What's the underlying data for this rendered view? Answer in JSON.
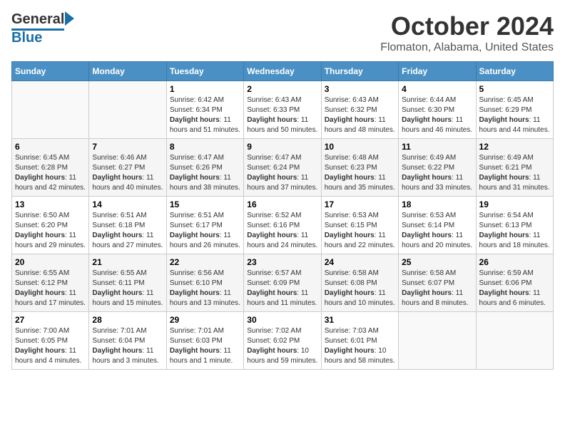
{
  "header": {
    "logo_line1": "General",
    "logo_line2": "Blue",
    "title": "October 2024",
    "subtitle": "Flomaton, Alabama, United States"
  },
  "calendar": {
    "days_of_week": [
      "Sunday",
      "Monday",
      "Tuesday",
      "Wednesday",
      "Thursday",
      "Friday",
      "Saturday"
    ],
    "weeks": [
      [
        {
          "day": "",
          "info": ""
        },
        {
          "day": "",
          "info": ""
        },
        {
          "day": "1",
          "info": "Sunrise: 6:42 AM\nSunset: 6:34 PM\nDaylight: 11 hours and 51 minutes."
        },
        {
          "day": "2",
          "info": "Sunrise: 6:43 AM\nSunset: 6:33 PM\nDaylight: 11 hours and 50 minutes."
        },
        {
          "day": "3",
          "info": "Sunrise: 6:43 AM\nSunset: 6:32 PM\nDaylight: 11 hours and 48 minutes."
        },
        {
          "day": "4",
          "info": "Sunrise: 6:44 AM\nSunset: 6:30 PM\nDaylight: 11 hours and 46 minutes."
        },
        {
          "day": "5",
          "info": "Sunrise: 6:45 AM\nSunset: 6:29 PM\nDaylight: 11 hours and 44 minutes."
        }
      ],
      [
        {
          "day": "6",
          "info": "Sunrise: 6:45 AM\nSunset: 6:28 PM\nDaylight: 11 hours and 42 minutes."
        },
        {
          "day": "7",
          "info": "Sunrise: 6:46 AM\nSunset: 6:27 PM\nDaylight: 11 hours and 40 minutes."
        },
        {
          "day": "8",
          "info": "Sunrise: 6:47 AM\nSunset: 6:26 PM\nDaylight: 11 hours and 38 minutes."
        },
        {
          "day": "9",
          "info": "Sunrise: 6:47 AM\nSunset: 6:24 PM\nDaylight: 11 hours and 37 minutes."
        },
        {
          "day": "10",
          "info": "Sunrise: 6:48 AM\nSunset: 6:23 PM\nDaylight: 11 hours and 35 minutes."
        },
        {
          "day": "11",
          "info": "Sunrise: 6:49 AM\nSunset: 6:22 PM\nDaylight: 11 hours and 33 minutes."
        },
        {
          "day": "12",
          "info": "Sunrise: 6:49 AM\nSunset: 6:21 PM\nDaylight: 11 hours and 31 minutes."
        }
      ],
      [
        {
          "day": "13",
          "info": "Sunrise: 6:50 AM\nSunset: 6:20 PM\nDaylight: 11 hours and 29 minutes."
        },
        {
          "day": "14",
          "info": "Sunrise: 6:51 AM\nSunset: 6:18 PM\nDaylight: 11 hours and 27 minutes."
        },
        {
          "day": "15",
          "info": "Sunrise: 6:51 AM\nSunset: 6:17 PM\nDaylight: 11 hours and 26 minutes."
        },
        {
          "day": "16",
          "info": "Sunrise: 6:52 AM\nSunset: 6:16 PM\nDaylight: 11 hours and 24 minutes."
        },
        {
          "day": "17",
          "info": "Sunrise: 6:53 AM\nSunset: 6:15 PM\nDaylight: 11 hours and 22 minutes."
        },
        {
          "day": "18",
          "info": "Sunrise: 6:53 AM\nSunset: 6:14 PM\nDaylight: 11 hours and 20 minutes."
        },
        {
          "day": "19",
          "info": "Sunrise: 6:54 AM\nSunset: 6:13 PM\nDaylight: 11 hours and 18 minutes."
        }
      ],
      [
        {
          "day": "20",
          "info": "Sunrise: 6:55 AM\nSunset: 6:12 PM\nDaylight: 11 hours and 17 minutes."
        },
        {
          "day": "21",
          "info": "Sunrise: 6:55 AM\nSunset: 6:11 PM\nDaylight: 11 hours and 15 minutes."
        },
        {
          "day": "22",
          "info": "Sunrise: 6:56 AM\nSunset: 6:10 PM\nDaylight: 11 hours and 13 minutes."
        },
        {
          "day": "23",
          "info": "Sunrise: 6:57 AM\nSunset: 6:09 PM\nDaylight: 11 hours and 11 minutes."
        },
        {
          "day": "24",
          "info": "Sunrise: 6:58 AM\nSunset: 6:08 PM\nDaylight: 11 hours and 10 minutes."
        },
        {
          "day": "25",
          "info": "Sunrise: 6:58 AM\nSunset: 6:07 PM\nDaylight: 11 hours and 8 minutes."
        },
        {
          "day": "26",
          "info": "Sunrise: 6:59 AM\nSunset: 6:06 PM\nDaylight: 11 hours and 6 minutes."
        }
      ],
      [
        {
          "day": "27",
          "info": "Sunrise: 7:00 AM\nSunset: 6:05 PM\nDaylight: 11 hours and 4 minutes."
        },
        {
          "day": "28",
          "info": "Sunrise: 7:01 AM\nSunset: 6:04 PM\nDaylight: 11 hours and 3 minutes."
        },
        {
          "day": "29",
          "info": "Sunrise: 7:01 AM\nSunset: 6:03 PM\nDaylight: 11 hours and 1 minute."
        },
        {
          "day": "30",
          "info": "Sunrise: 7:02 AM\nSunset: 6:02 PM\nDaylight: 10 hours and 59 minutes."
        },
        {
          "day": "31",
          "info": "Sunrise: 7:03 AM\nSunset: 6:01 PM\nDaylight: 10 hours and 58 minutes."
        },
        {
          "day": "",
          "info": ""
        },
        {
          "day": "",
          "info": ""
        }
      ]
    ]
  }
}
